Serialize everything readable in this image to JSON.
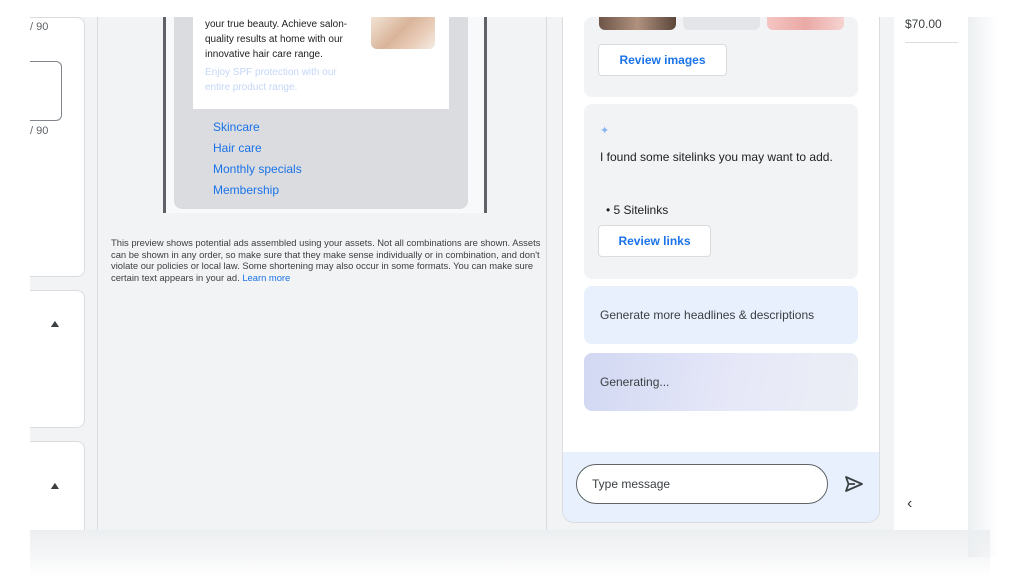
{
  "left_column": {
    "counter_top": "/ 90",
    "counter_second": "/ 90"
  },
  "preview": {
    "ad_body_lines": [
      "your true beauty. Achieve salon-",
      "quality results at home with our",
      "innovative hair care range."
    ],
    "ad_faded_lines": [
      "Enjoy SPF protection with our",
      "entire product range."
    ],
    "sitelinks": [
      "Skincare",
      "Hair care",
      "Monthly specials",
      "Membership"
    ],
    "disclaimer": "This preview shows potential ads assembled using your assets. Not all combinations are shown. Assets can be shown in any order, so make sure that they make sense individually or in combination, and don't violate our policies or local law. Some shortening may also occur in some formats. You can make sure certain text appears in your ad.",
    "learn_more": "Learn more"
  },
  "chat": {
    "review_images_label": "Review images",
    "sitelinks_message": "I found some sitelinks you may want to add.",
    "sitelinks_bullet": "• 5 Sitelinks",
    "review_links_label": "Review links",
    "generate_more_label": "Generate more headlines & descriptions",
    "generating_label": "Generating...",
    "message_placeholder": "Type message"
  },
  "right_column": {
    "price": "$70.00"
  },
  "icons": {
    "sparkle": "sparkle-icon",
    "send": "send-icon",
    "chevron_up": "chevron-up-icon",
    "chevron_left": "chevron-left-icon"
  },
  "colors": {
    "link": "#1a73e8",
    "canvas": "#f1f3f4",
    "composer_bg": "#e8f0fe"
  }
}
